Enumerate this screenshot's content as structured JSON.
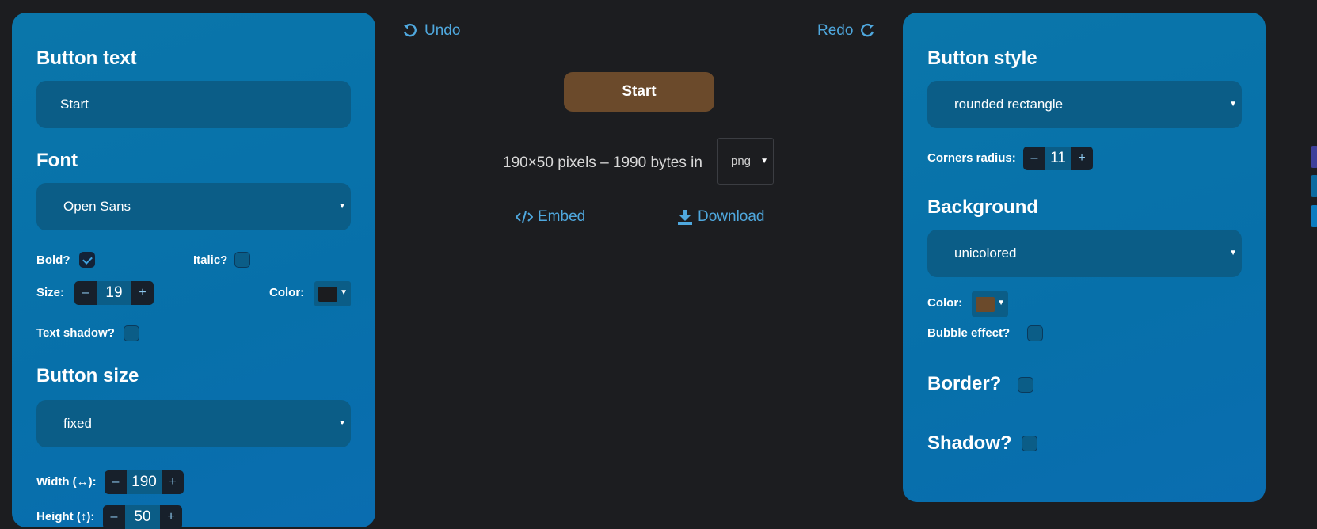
{
  "left": {
    "button_text_heading": "Button text",
    "button_text_value": "Start",
    "font_heading": "Font",
    "font_value": "Open Sans",
    "bold_label": "Bold?",
    "italic_label": "Italic?",
    "size_label": "Size:",
    "size_value": "19",
    "color_label": "Color:",
    "text_color": "#1b1c1f",
    "text_shadow_label": "Text shadow?",
    "button_size_heading": "Button size",
    "button_size_value": "fixed",
    "width_label": "Width (↔):",
    "width_value": "190",
    "height_label": "Height (↕):",
    "height_value": "50"
  },
  "center": {
    "undo_label": "Undo",
    "redo_label": "Redo",
    "preview_text": "Start",
    "info_text": "190×50 pixels – 1990 bytes in",
    "format_value": "png",
    "embed_label": "Embed",
    "download_label": "Download",
    "button_bg_color": "#6b4a2b"
  },
  "right": {
    "button_style_heading": "Button style",
    "button_style_value": "rounded rectangle",
    "corners_radius_label": "Corners radius:",
    "corners_radius_value": "11",
    "background_heading": "Background",
    "background_value": "unicolored",
    "color_label": "Color:",
    "bg_color": "#6b4a2b",
    "bubble_label": "Bubble effect?",
    "border_heading": "Border?",
    "shadow_heading": "Shadow?"
  },
  "icons": {
    "undo": "undo-arrow-icon",
    "redo": "redo-arrow-icon",
    "embed": "code-icon",
    "download": "download-icon"
  }
}
